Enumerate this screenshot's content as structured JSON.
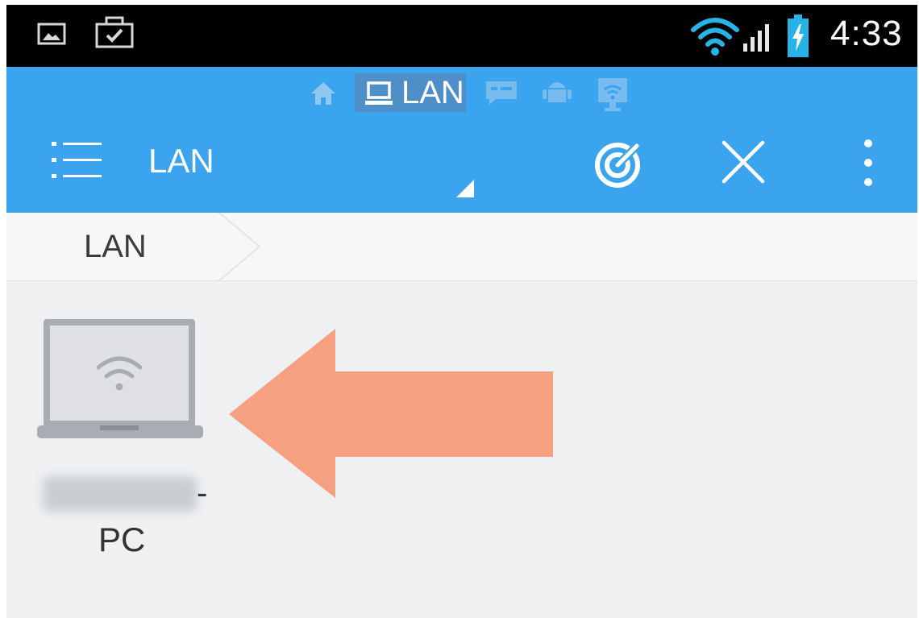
{
  "status_bar": {
    "time": "4:33",
    "icons": [
      "gallery-icon",
      "work-bag-icon",
      "wifi-icon",
      "signal-icon",
      "battery-charging-icon"
    ]
  },
  "nav_strip": {
    "items": [
      {
        "name": "home-icon",
        "label": ""
      },
      {
        "name": "lan",
        "label": "LAN",
        "selected": true
      },
      {
        "name": "ftp-icon",
        "label": ""
      },
      {
        "name": "android-icon",
        "label": ""
      },
      {
        "name": "remote-icon",
        "label": ""
      }
    ]
  },
  "toolbar": {
    "title": "LAN",
    "actions": [
      "menu-icon",
      "scan-radar-icon",
      "close-icon",
      "more-vertical-icon"
    ]
  },
  "breadcrumb": {
    "items": [
      "LAN"
    ]
  },
  "devices": [
    {
      "name_line1_suffix": "-",
      "name_line2": "PC",
      "name_obscured": true,
      "icon": "laptop-wifi-icon"
    }
  ],
  "annotation": {
    "arrow_color": "#f5a080"
  },
  "colors": {
    "toolbar": "#3aa4ef",
    "status_bar": "#000000",
    "content_bg": "#eef0f2",
    "wifi_status": "#27b3e6"
  }
}
